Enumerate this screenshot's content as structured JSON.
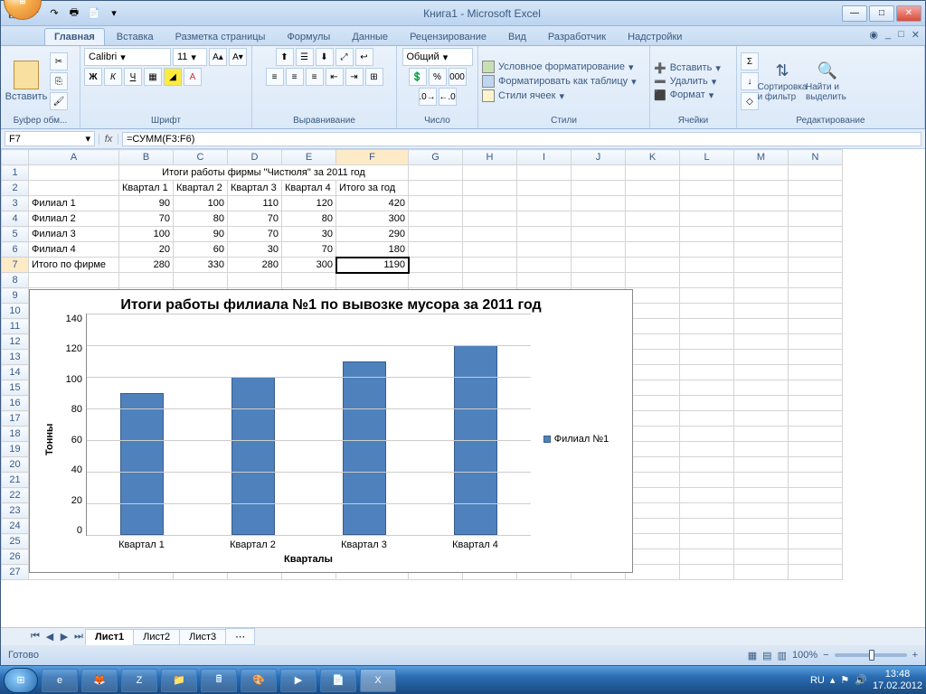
{
  "window": {
    "title": "Книга1 - Microsoft Excel",
    "qat_icons": [
      "save-icon",
      "undo-icon",
      "redo-icon",
      "print-icon",
      "preview-icon"
    ]
  },
  "tabs": {
    "items": [
      "Главная",
      "Вставка",
      "Разметка страницы",
      "Формулы",
      "Данные",
      "Рецензирование",
      "Вид",
      "Разработчик",
      "Надстройки"
    ],
    "active": 0
  },
  "ribbon": {
    "clipboard": {
      "label": "Буфер обм...",
      "paste": "Вставить"
    },
    "font": {
      "label": "Шрифт",
      "name": "Calibri",
      "size": "11",
      "bold": "Ж",
      "italic": "К",
      "underline": "Ч"
    },
    "alignment": {
      "label": "Выравнивание"
    },
    "number": {
      "label": "Число",
      "format": "Общий"
    },
    "styles": {
      "label": "Стили",
      "cond": "Условное форматирование",
      "table": "Форматировать как таблицу",
      "cell": "Стили ячеек"
    },
    "cells": {
      "label": "Ячейки",
      "insert": "Вставить",
      "delete": "Удалить",
      "format": "Формат"
    },
    "editing": {
      "label": "Редактирование",
      "sort": "Сортировка и фильтр",
      "find": "Найти и выделить"
    }
  },
  "formula_bar": {
    "name_box": "F7",
    "fx": "fx",
    "formula": "=СУММ(F3:F6)"
  },
  "grid": {
    "columns": [
      "A",
      "B",
      "C",
      "D",
      "E",
      "F",
      "G",
      "H",
      "I",
      "J",
      "K",
      "L",
      "M",
      "N"
    ],
    "rows": [
      {
        "n": 1,
        "cells": [
          "",
          "Итоги работы фирмы \"Чистюля\" за 2011 год",
          "",
          "",
          "",
          "",
          "",
          "",
          "",
          "",
          "",
          "",
          "",
          ""
        ],
        "span_from": 1
      },
      {
        "n": 2,
        "cells": [
          "",
          "Квартал 1",
          "Квартал 2",
          "Квартал 3",
          "Квартал 4",
          "Итого за год",
          "",
          "",
          "",
          "",
          "",
          "",
          "",
          ""
        ]
      },
      {
        "n": 3,
        "cells": [
          "Филиал 1",
          "90",
          "100",
          "110",
          "120",
          "420",
          "",
          "",
          "",
          "",
          "",
          "",
          "",
          ""
        ]
      },
      {
        "n": 4,
        "cells": [
          "Филиал 2",
          "70",
          "80",
          "70",
          "80",
          "300",
          "",
          "",
          "",
          "",
          "",
          "",
          "",
          ""
        ]
      },
      {
        "n": 5,
        "cells": [
          "Филиал 3",
          "100",
          "90",
          "70",
          "30",
          "290",
          "",
          "",
          "",
          "",
          "",
          "",
          "",
          ""
        ]
      },
      {
        "n": 6,
        "cells": [
          "Филиал 4",
          "20",
          "60",
          "30",
          "70",
          "180",
          "",
          "",
          "",
          "",
          "",
          "",
          "",
          ""
        ]
      },
      {
        "n": 7,
        "cells": [
          "Итого по фирме",
          "280",
          "330",
          "280",
          "300",
          "1190",
          "",
          "",
          "",
          "",
          "",
          "",
          "",
          ""
        ]
      },
      {
        "n": 8,
        "cells": [
          "",
          "",
          "",
          "",
          "",
          "",
          "",
          "",
          "",
          "",
          "",
          "",
          "",
          ""
        ]
      },
      {
        "n": 9,
        "cells": [
          "",
          "",
          "",
          "",
          "",
          "",
          "",
          "",
          "",
          "",
          "",
          "",
          "",
          ""
        ]
      }
    ],
    "selected": {
      "col": "F",
      "row": 7
    }
  },
  "chart_data": {
    "type": "bar",
    "title": "Итоги работы филиала №1 по вывозке мусора за 2011 год",
    "ylabel": "Тонны",
    "xlabel": "Кварталы",
    "categories": [
      "Квартал 1",
      "Квартал 2",
      "Квартал 3",
      "Квартал 4"
    ],
    "series": [
      {
        "name": "Филиал №1",
        "values": [
          90,
          100,
          110,
          120
        ]
      }
    ],
    "ylim": [
      0,
      140
    ],
    "yticks": [
      0,
      20,
      40,
      60,
      80,
      100,
      120,
      140
    ]
  },
  "sheet_tabs": {
    "items": [
      "Лист1",
      "Лист2",
      "Лист3"
    ],
    "active": 0
  },
  "statusbar": {
    "ready": "Готово",
    "zoom": "100%"
  },
  "taskbar": {
    "lang": "RU",
    "date": "17.02.2012",
    "time": "13:48"
  }
}
